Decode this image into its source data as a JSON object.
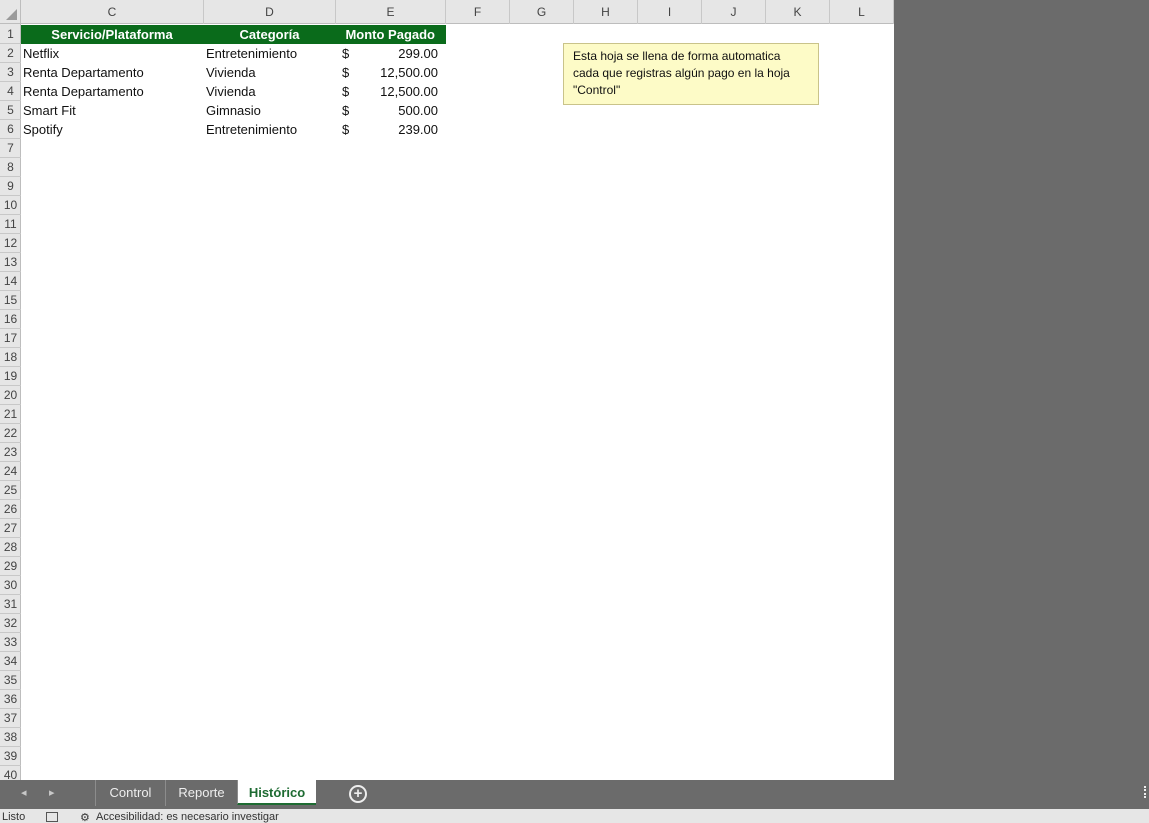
{
  "columns": [
    "C",
    "D",
    "E",
    "F",
    "G",
    "H",
    "I",
    "J",
    "K",
    "L"
  ],
  "rows": [
    "1",
    "2",
    "3",
    "4",
    "5",
    "6",
    "7",
    "8",
    "9",
    "10",
    "11",
    "12",
    "13",
    "14",
    "15",
    "16",
    "17",
    "18",
    "19",
    "20",
    "21",
    "22",
    "23",
    "24",
    "25",
    "26",
    "27",
    "28",
    "29",
    "30",
    "31",
    "32",
    "33",
    "34",
    "35",
    "36",
    "37",
    "38",
    "39",
    "40"
  ],
  "table": {
    "headers": {
      "service": "Servicio/Plataforma",
      "category": "Categoría",
      "amount": "Monto Pagado"
    },
    "currency_symbol": "$",
    "records": [
      {
        "service": "Netflix",
        "category": "Entretenimiento",
        "amount": "299.00"
      },
      {
        "service": "Renta Departamento",
        "category": "Vivienda",
        "amount": "12,500.00"
      },
      {
        "service": "Renta Departamento",
        "category": "Vivienda",
        "amount": "12,500.00"
      },
      {
        "service": "Smart Fit",
        "category": "Gimnasio",
        "amount": "500.00"
      },
      {
        "service": "Spotify",
        "category": "Entretenimiento",
        "amount": "239.00"
      }
    ]
  },
  "note": {
    "text": "Esta hoja se llena de forma automatica cada que registras algún pago en la hoja \"Control\""
  },
  "sheet_tabs": [
    {
      "label": "Control",
      "active": false
    },
    {
      "label": "Reporte",
      "active": false
    },
    {
      "label": "Histórico",
      "active": true
    }
  ],
  "colors": {
    "header_green": "#0a6b1b",
    "note_bg": "#fdfbc7",
    "active_tab_text": "#1e6b32"
  },
  "icons": {
    "prev_sheet": "◂",
    "next_sheet": "▸",
    "add_sheet": "+"
  },
  "status": {
    "ready": "Listo",
    "accessibility": "Accesibilidad: es necesario investigar"
  }
}
